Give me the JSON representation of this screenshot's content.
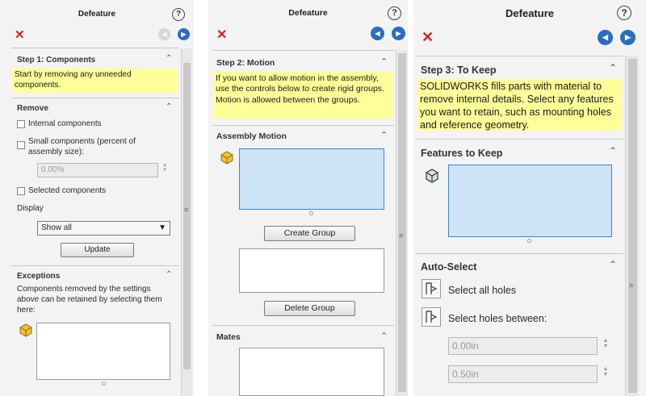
{
  "panel1": {
    "title": "Defeature",
    "help_label": "?",
    "close_label": "✕",
    "back_label": "◀",
    "forward_label": "▶",
    "step": {
      "header": "Step 1: Components",
      "note": "Start by removing any unneeded components."
    },
    "remove": {
      "header": "Remove",
      "internal_label": "Internal components",
      "small_label": "Small components (percent of assembly size):",
      "percent_value": "0.00%",
      "selected_label": "Selected components",
      "display_label": "Display",
      "display_value": "Show all",
      "update_label": "Update"
    },
    "exceptions": {
      "header": "Exceptions",
      "description": "Components removed by the settings above can be retained by selecting them here:"
    }
  },
  "panel2": {
    "title": "Defeature",
    "help_label": "?",
    "close_label": "✕",
    "back_label": "◀",
    "forward_label": "▶",
    "step": {
      "header": "Step 2: Motion",
      "note": "If you want to allow motion in the assembly, use the controls below to create rigid groups. Motion is allowed between the groups."
    },
    "motion": {
      "header": "Assembly Motion",
      "create_label": "Create Group",
      "delete_label": "Delete Group"
    },
    "mates": {
      "header": "Mates"
    }
  },
  "panel3": {
    "title": "Defeature",
    "help_label": "?",
    "close_label": "✕",
    "back_label": "◀",
    "forward_label": "▶",
    "step": {
      "header": "Step 3: To Keep",
      "note": "SOLIDWORKS fills parts with material to remove internal details. Select any features you want to retain, such as mounting holes and reference geometry."
    },
    "keep": {
      "header": "Features to Keep"
    },
    "auto": {
      "header": "Auto-Select",
      "all_holes_label": "Select all holes",
      "between_label": "Select holes between:",
      "min_value": "0.00in",
      "max_value": "0.50in"
    }
  },
  "icons": {
    "help": "help-circle-icon",
    "close": "close-x-icon",
    "back": "back-arrow-icon",
    "forward": "forward-arrow-icon",
    "chevron": "chevron-up-icon",
    "component": "component-cube-icon",
    "feature": "feature-cube-icon",
    "holes": "hole-wizard-icon"
  },
  "colors": {
    "note_bg": "#ffff99",
    "nav_blue": "#2a6cc4",
    "close_red": "#d42020",
    "selection_blue": "#cde3f8"
  }
}
